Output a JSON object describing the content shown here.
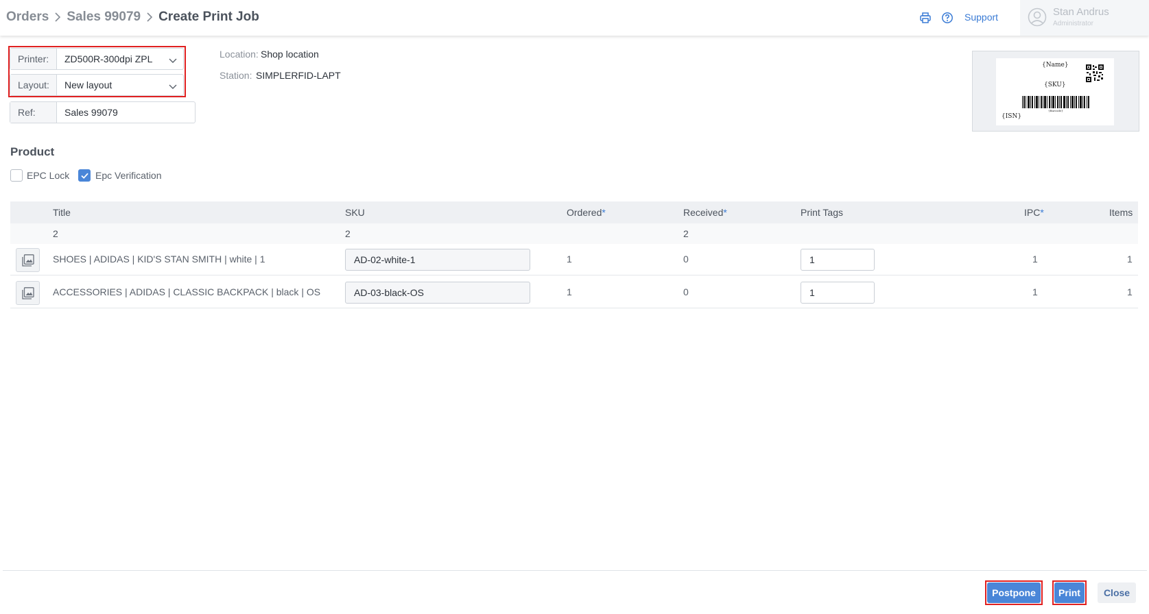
{
  "breadcrumb": {
    "items": [
      "Orders",
      "Sales 99079",
      "Create Print Job"
    ]
  },
  "header": {
    "support_label": "Support",
    "icons": [
      "printer-icon",
      "help-icon",
      "user-icon"
    ]
  },
  "user": {
    "name": "Stan Andrus",
    "role": "Administrator"
  },
  "form": {
    "printer_label": "Printer:",
    "printer_value": "ZD500R-300dpi ZPL",
    "layout_label": "Layout:",
    "layout_value": "New layout",
    "ref_label": "Ref:",
    "ref_value": "Sales 99079"
  },
  "info": {
    "location_label": "Location:",
    "location_value": "Shop location",
    "station_label": "Station:",
    "station_value": "SIMPLERFID-LAPT"
  },
  "label_preview": {
    "name_field": "{Name}",
    "sku_field": "{SKU}",
    "isn_field": "{ISN}",
    "barcode_caption": "{Barcode}"
  },
  "product": {
    "section_title": "Product",
    "epc_lock_label": "EPC Lock",
    "epc_lock_checked": false,
    "epc_verification_label": "Epc Verification",
    "epc_verification_checked": true
  },
  "table": {
    "columns": {
      "title": "Title",
      "sku": "SKU",
      "ordered": "Ordered",
      "received": "Received",
      "print_tags": "Print Tags",
      "ipc": "IPC",
      "items": "Items",
      "required_marker": "*"
    },
    "summary": {
      "title": "2",
      "sku": "2",
      "received": "2"
    },
    "rows": [
      {
        "title": "SHOES | ADIDAS | KID'S STAN SMITH | white | 1",
        "sku": "AD-02-white-1",
        "ordered": "1",
        "received": "0",
        "print_tags": "1",
        "ipc": "1",
        "items": "1"
      },
      {
        "title": "ACCESSORIES | ADIDAS | CLASSIC BACKPACK | black | OS",
        "sku": "AD-03-black-OS",
        "ordered": "1",
        "received": "0",
        "print_tags": "1",
        "ipc": "1",
        "items": "1"
      }
    ]
  },
  "footer": {
    "postpone_label": "Postpone",
    "print_label": "Print",
    "close_label": "Close"
  },
  "colors": {
    "accent": "#4a86d8",
    "link": "#3a7bd5",
    "highlight": "#e02020"
  }
}
